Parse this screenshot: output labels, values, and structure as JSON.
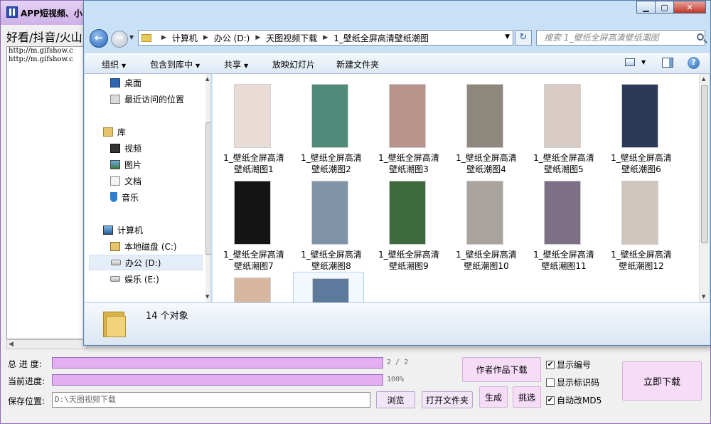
{
  "app": {
    "title": "APP短视频、小",
    "header_text": "好看/抖音/火山",
    "urls": [
      "http://m.gifshow.c",
      "http://m.gifshow.c"
    ],
    "total_progress": {
      "label": "总 进 度:",
      "text": "2 / 2",
      "fraction": 1.0
    },
    "current_progress": {
      "label": "当前进度:",
      "text": "100%",
      "fraction": 1.0
    },
    "save_location": {
      "label": "保存位置:",
      "value": "D:\\天图视频下载"
    },
    "buttons": {
      "browse": "浏览",
      "open_folder": "打开文件夹",
      "generate": "生成",
      "pick": "挑选",
      "author_download": "作者作品下载",
      "download_now": "立即下载"
    },
    "checkboxes": [
      {
        "label": "显示编号",
        "checked": true
      },
      {
        "label": "显示标识码",
        "checked": false
      },
      {
        "label": "自动改MD5",
        "checked": true
      }
    ]
  },
  "explorer": {
    "breadcrumbs": [
      "计算机",
      "办公 (D:)",
      "天图视频下载",
      "1_壁纸全屏高清壁纸潮图"
    ],
    "search_placeholder": "搜索 1_壁纸全屏高清壁纸潮图",
    "toolbar": {
      "organize": "组织",
      "include_in_library": "包含到库中",
      "share": "共享",
      "slideshow": "放映幻灯片",
      "new_folder": "新建文件夹"
    },
    "nav": {
      "desktop": "桌面",
      "recent": "最近访问的位置",
      "libraries": "库",
      "videos": "视频",
      "pictures": "图片",
      "documents": "文档",
      "music": "音乐",
      "computer": "计算机",
      "drive_c": "本地磁盘 (C:)",
      "drive_d": "办公 (D:)",
      "drive_e": "娱乐 (E:)"
    },
    "files": [
      {
        "line1": "1_壁纸全屏高清",
        "line2": "壁纸潮图1",
        "color": "#e9dcd6"
      },
      {
        "line1": "1_壁纸全屏高清",
        "line2": "壁纸潮图2",
        "color": "#4f8a7a"
      },
      {
        "line1": "1_壁纸全屏高清",
        "line2": "壁纸潮图3",
        "color": "#b9948a"
      },
      {
        "line1": "1_壁纸全屏高清",
        "line2": "壁纸潮图4",
        "color": "#8e877c"
      },
      {
        "line1": "1_壁纸全屏高清",
        "line2": "壁纸潮图5",
        "color": "#d8cbc4"
      },
      {
        "line1": "1_壁纸全屏高清",
        "line2": "壁纸潮图6",
        "color": "#2b3b57"
      },
      {
        "line1": "1_壁纸全屏高清",
        "line2": "壁纸潮图7",
        "color": "#141414"
      },
      {
        "line1": "1_壁纸全屏高清",
        "line2": "壁纸潮图8",
        "color": "#7f94a8"
      },
      {
        "line1": "1_壁纸全屏高清",
        "line2": "壁纸潮图9",
        "color": "#3f6a3d"
      },
      {
        "line1": "1_壁纸全屏高清",
        "line2": "壁纸潮图10",
        "color": "#a9a39d"
      },
      {
        "line1": "1_壁纸全屏高清",
        "line2": "壁纸潮图11",
        "color": "#7d6f86"
      },
      {
        "line1": "1_壁纸全屏高清",
        "line2": "壁纸潮图12",
        "color": "#cfc5bd"
      },
      {
        "line1": "",
        "line2": "",
        "color": "#d7b7a0"
      },
      {
        "line1": "",
        "line2": "",
        "color": "#5d7a9c"
      }
    ],
    "status": "14 个对象"
  }
}
